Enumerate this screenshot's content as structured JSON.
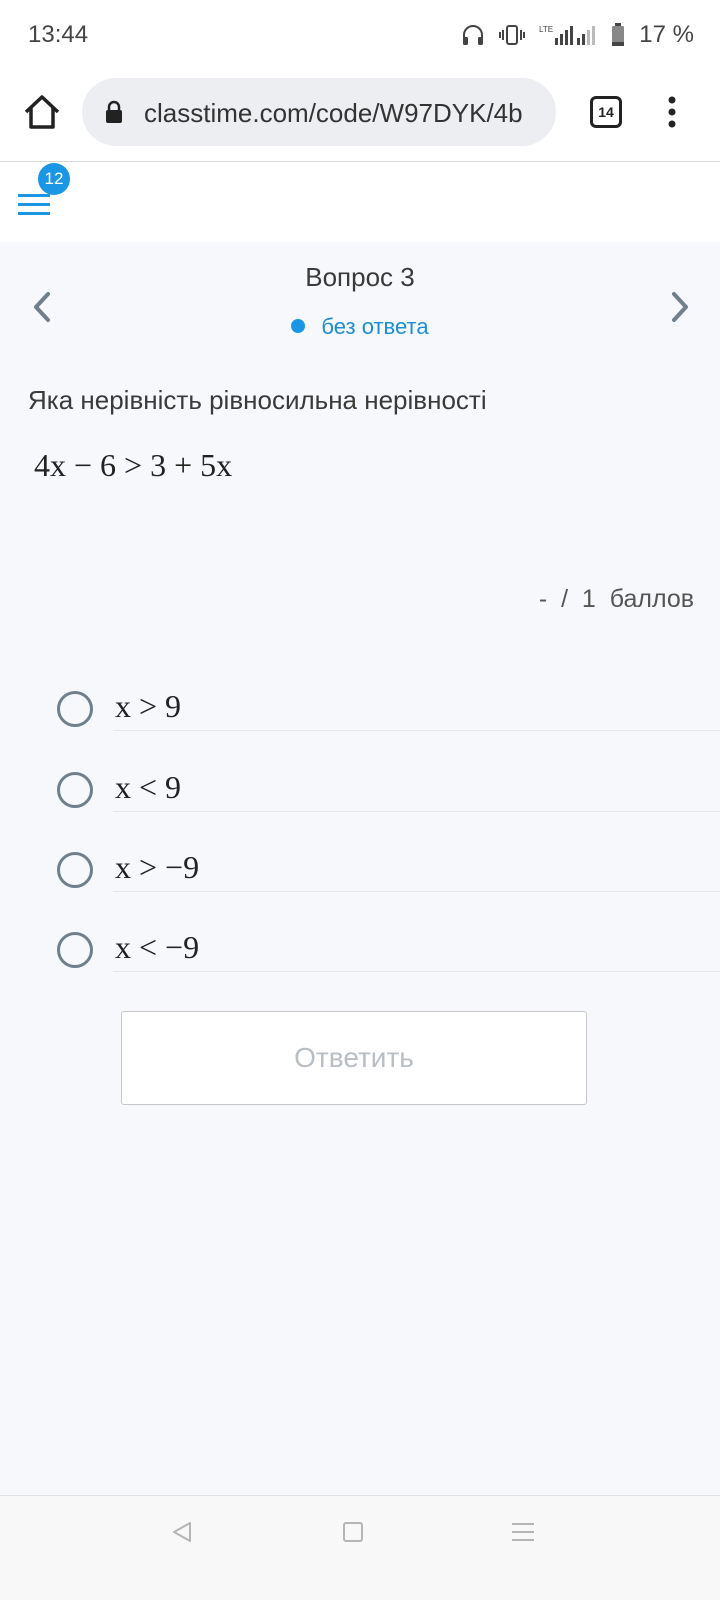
{
  "status_bar": {
    "time": "13:44",
    "battery": "17 %",
    "network": "LTE"
  },
  "browser": {
    "url": "classtime.com/code/W97DYK/4b",
    "tab_count": "14"
  },
  "app": {
    "notification_count": "12"
  },
  "question": {
    "title": "Вопрос 3",
    "status": "без ответа",
    "text": "Яка нерівність рівносильна нерівності",
    "formula": "4x − 6 > 3 + 5x",
    "score": "-  /  1  баллов"
  },
  "options": [
    "x > 9",
    "x < 9",
    "x > −9",
    "x < −9"
  ],
  "submit_label": "Ответить",
  "colors": {
    "accent": "#1b96e5",
    "background": "#f6f8fb",
    "radio": "#6f7f8c"
  }
}
